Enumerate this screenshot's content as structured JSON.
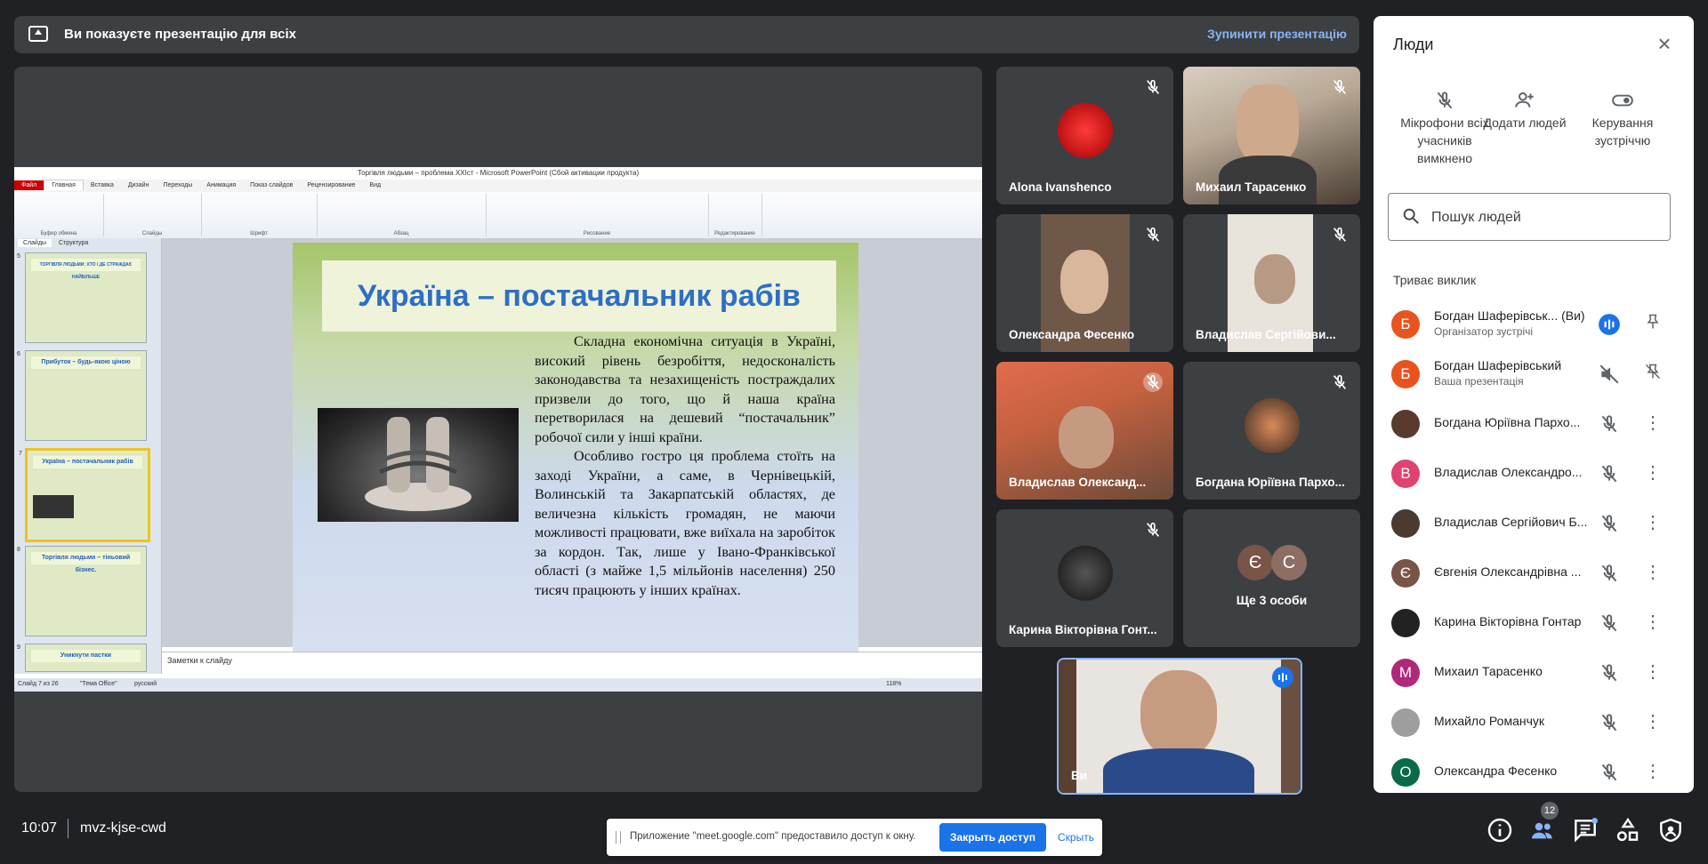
{
  "presenting_bar": {
    "text": "Ви показуєте презентацію для всіх",
    "stop_label": "Зупинити презентацію"
  },
  "ppt": {
    "window_title": "Торгівля людьми – проблема XXIст - Microsoft PowerPoint (Сбой активации продукта)",
    "tabs": [
      "Файл",
      "Главная",
      "Вставка",
      "Дизайн",
      "Переходы",
      "Анимация",
      "Показ слайдов",
      "Рецензирование",
      "Вид"
    ],
    "ribbon_groups": [
      "Буфер обмена",
      "Слайды",
      "Шрифт",
      "Абзац",
      "Рисование",
      "Редактирование"
    ],
    "panel_tabs": [
      "Слайды",
      "Структура"
    ],
    "thumbs": [
      {
        "num": "5",
        "title": "ТОРГІВЛЯ ЛЮДЬМИ: ХТО І ДЕ СТРАЖДАЄ НАЙБІЛЬШЕ"
      },
      {
        "num": "6",
        "title": "Прибуток – будь-якою ціною"
      },
      {
        "num": "7",
        "title": "Україна – постачальник рабів"
      },
      {
        "num": "8",
        "title": "Торгівля людьми – тіньовий бізнес."
      },
      {
        "num": "9",
        "title": "Уникнути пастки"
      }
    ],
    "slide_title": "Україна – постачальник рабів",
    "slide_para1": "Складна економічна ситуація в Україні, високий рівень безробіття, недосконалість законодавства та незахищеність постраждалих призвели до того, що й наша країна перетворилася на дешевий “постачальник” робочої сили у інші країни.",
    "slide_para2": "Особливо гостро ця проблема стоїть на заході України, а саме, в Чернівецькій, Волинській та Закарпатській областях, де величезна кількість громадян, не маючи можливості працювати, вже виїхала на заробіток за кордон. Так, лише у Івано-Франківської області (з майже 1,5 мільйонів населення) 250 тисяч працюють у інших країнах.",
    "notes_placeholder": "Заметки к слайду",
    "status_slide": "Слайд 7 из 26",
    "status_theme": "\"Тема Office\"",
    "status_lang": "русский",
    "zoom": "118%"
  },
  "tiles": [
    {
      "name": "Alona Ivanshenco",
      "avatar_color": "#c62828"
    },
    {
      "name": "Михаил Тарасенко"
    },
    {
      "name": "Олександра Фесенко"
    },
    {
      "name": "Владислав Сергійови..."
    },
    {
      "name": "Владислав Олександ..."
    },
    {
      "name": "Богдана Юріївна Пархо..."
    },
    {
      "name": "Карина Вікторівна Гонт..."
    },
    {
      "name": "Ще 3 особи",
      "initials": [
        "Є",
        "С"
      ]
    }
  ],
  "self_tile": {
    "name": "Ви"
  },
  "people_panel": {
    "title": "Люди",
    "actions": [
      {
        "label": "Мікрофони всіх учасників вимкнено",
        "icon": "mic-off-icon"
      },
      {
        "label": "Додати людей",
        "icon": "person-add-icon"
      },
      {
        "label": "Керування зустріччю",
        "icon": "toggle-icon"
      }
    ],
    "search_placeholder": "Пошук людей",
    "section_label": "Триває виклик",
    "participants": [
      {
        "name": "Богдан Шаферівськ...  (Ви)",
        "sub": "Організатор зустрічі",
        "initial": "Б",
        "color": "#e8541d"
      },
      {
        "name": "Богдан Шаферівський",
        "sub": "Ваша презентація",
        "initial": "Б",
        "color": "#e8541d"
      },
      {
        "name": "Богдана Юріївна Пархо...",
        "initial": "",
        "color": "#5a3a2e"
      },
      {
        "name": "Владислав Олександро...",
        "initial": "В",
        "color": "#e04370"
      },
      {
        "name": "Владислав Сергійович Б...",
        "initial": "",
        "color": "#4a3a30"
      },
      {
        "name": "Євгенія Олександрівна ...",
        "initial": "Є",
        "color": "#795548"
      },
      {
        "name": "Карина Вікторівна Гонтар",
        "initial": "",
        "color": "#222"
      },
      {
        "name": "Михаил Тарасенко",
        "initial": "М",
        "color": "#b0287a"
      },
      {
        "name": "Михайло Романчук",
        "initial": "",
        "color": "#9e9e9e"
      },
      {
        "name": "Олександра Фесенко",
        "initial": "О",
        "color": "#0b6a4a"
      }
    ]
  },
  "bottom": {
    "time": "10:07",
    "meeting_code": "mvz-kjse-cwd",
    "people_count": "12"
  },
  "share_notice": {
    "text": "Приложение \"meet.google.com\" предоставило доступ к окну.",
    "stop_label": "Закрыть доступ",
    "hide_label": "Скрыть"
  }
}
